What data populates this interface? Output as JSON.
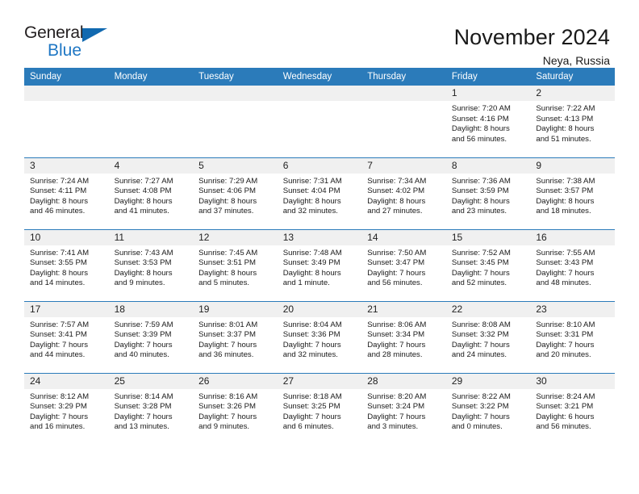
{
  "brand": {
    "name_part1": "General",
    "name_part2": "Blue"
  },
  "header": {
    "title": "November 2024",
    "location": "Neya, Russia"
  },
  "weekday_headers": [
    "Sunday",
    "Monday",
    "Tuesday",
    "Wednesday",
    "Thursday",
    "Friday",
    "Saturday"
  ],
  "colors": {
    "header_blue": "#2b7bba",
    "brand_blue": "#1f77c4",
    "daynum_band": "#f0f0f0",
    "text": "#1a1a1a"
  },
  "weeks": [
    [
      {
        "day": "",
        "empty": true
      },
      {
        "day": "",
        "empty": true
      },
      {
        "day": "",
        "empty": true
      },
      {
        "day": "",
        "empty": true
      },
      {
        "day": "",
        "empty": true
      },
      {
        "day": "1",
        "sunrise": "Sunrise: 7:20 AM",
        "sunset": "Sunset: 4:16 PM",
        "daylight1": "Daylight: 8 hours",
        "daylight2": "and 56 minutes."
      },
      {
        "day": "2",
        "sunrise": "Sunrise: 7:22 AM",
        "sunset": "Sunset: 4:13 PM",
        "daylight1": "Daylight: 8 hours",
        "daylight2": "and 51 minutes."
      }
    ],
    [
      {
        "day": "3",
        "sunrise": "Sunrise: 7:24 AM",
        "sunset": "Sunset: 4:11 PM",
        "daylight1": "Daylight: 8 hours",
        "daylight2": "and 46 minutes."
      },
      {
        "day": "4",
        "sunrise": "Sunrise: 7:27 AM",
        "sunset": "Sunset: 4:08 PM",
        "daylight1": "Daylight: 8 hours",
        "daylight2": "and 41 minutes."
      },
      {
        "day": "5",
        "sunrise": "Sunrise: 7:29 AM",
        "sunset": "Sunset: 4:06 PM",
        "daylight1": "Daylight: 8 hours",
        "daylight2": "and 37 minutes."
      },
      {
        "day": "6",
        "sunrise": "Sunrise: 7:31 AM",
        "sunset": "Sunset: 4:04 PM",
        "daylight1": "Daylight: 8 hours",
        "daylight2": "and 32 minutes."
      },
      {
        "day": "7",
        "sunrise": "Sunrise: 7:34 AM",
        "sunset": "Sunset: 4:02 PM",
        "daylight1": "Daylight: 8 hours",
        "daylight2": "and 27 minutes."
      },
      {
        "day": "8",
        "sunrise": "Sunrise: 7:36 AM",
        "sunset": "Sunset: 3:59 PM",
        "daylight1": "Daylight: 8 hours",
        "daylight2": "and 23 minutes."
      },
      {
        "day": "9",
        "sunrise": "Sunrise: 7:38 AM",
        "sunset": "Sunset: 3:57 PM",
        "daylight1": "Daylight: 8 hours",
        "daylight2": "and 18 minutes."
      }
    ],
    [
      {
        "day": "10",
        "sunrise": "Sunrise: 7:41 AM",
        "sunset": "Sunset: 3:55 PM",
        "daylight1": "Daylight: 8 hours",
        "daylight2": "and 14 minutes."
      },
      {
        "day": "11",
        "sunrise": "Sunrise: 7:43 AM",
        "sunset": "Sunset: 3:53 PM",
        "daylight1": "Daylight: 8 hours",
        "daylight2": "and 9 minutes."
      },
      {
        "day": "12",
        "sunrise": "Sunrise: 7:45 AM",
        "sunset": "Sunset: 3:51 PM",
        "daylight1": "Daylight: 8 hours",
        "daylight2": "and 5 minutes."
      },
      {
        "day": "13",
        "sunrise": "Sunrise: 7:48 AM",
        "sunset": "Sunset: 3:49 PM",
        "daylight1": "Daylight: 8 hours",
        "daylight2": "and 1 minute."
      },
      {
        "day": "14",
        "sunrise": "Sunrise: 7:50 AM",
        "sunset": "Sunset: 3:47 PM",
        "daylight1": "Daylight: 7 hours",
        "daylight2": "and 56 minutes."
      },
      {
        "day": "15",
        "sunrise": "Sunrise: 7:52 AM",
        "sunset": "Sunset: 3:45 PM",
        "daylight1": "Daylight: 7 hours",
        "daylight2": "and 52 minutes."
      },
      {
        "day": "16",
        "sunrise": "Sunrise: 7:55 AM",
        "sunset": "Sunset: 3:43 PM",
        "daylight1": "Daylight: 7 hours",
        "daylight2": "and 48 minutes."
      }
    ],
    [
      {
        "day": "17",
        "sunrise": "Sunrise: 7:57 AM",
        "sunset": "Sunset: 3:41 PM",
        "daylight1": "Daylight: 7 hours",
        "daylight2": "and 44 minutes."
      },
      {
        "day": "18",
        "sunrise": "Sunrise: 7:59 AM",
        "sunset": "Sunset: 3:39 PM",
        "daylight1": "Daylight: 7 hours",
        "daylight2": "and 40 minutes."
      },
      {
        "day": "19",
        "sunrise": "Sunrise: 8:01 AM",
        "sunset": "Sunset: 3:37 PM",
        "daylight1": "Daylight: 7 hours",
        "daylight2": "and 36 minutes."
      },
      {
        "day": "20",
        "sunrise": "Sunrise: 8:04 AM",
        "sunset": "Sunset: 3:36 PM",
        "daylight1": "Daylight: 7 hours",
        "daylight2": "and 32 minutes."
      },
      {
        "day": "21",
        "sunrise": "Sunrise: 8:06 AM",
        "sunset": "Sunset: 3:34 PM",
        "daylight1": "Daylight: 7 hours",
        "daylight2": "and 28 minutes."
      },
      {
        "day": "22",
        "sunrise": "Sunrise: 8:08 AM",
        "sunset": "Sunset: 3:32 PM",
        "daylight1": "Daylight: 7 hours",
        "daylight2": "and 24 minutes."
      },
      {
        "day": "23",
        "sunrise": "Sunrise: 8:10 AM",
        "sunset": "Sunset: 3:31 PM",
        "daylight1": "Daylight: 7 hours",
        "daylight2": "and 20 minutes."
      }
    ],
    [
      {
        "day": "24",
        "sunrise": "Sunrise: 8:12 AM",
        "sunset": "Sunset: 3:29 PM",
        "daylight1": "Daylight: 7 hours",
        "daylight2": "and 16 minutes."
      },
      {
        "day": "25",
        "sunrise": "Sunrise: 8:14 AM",
        "sunset": "Sunset: 3:28 PM",
        "daylight1": "Daylight: 7 hours",
        "daylight2": "and 13 minutes."
      },
      {
        "day": "26",
        "sunrise": "Sunrise: 8:16 AM",
        "sunset": "Sunset: 3:26 PM",
        "daylight1": "Daylight: 7 hours",
        "daylight2": "and 9 minutes."
      },
      {
        "day": "27",
        "sunrise": "Sunrise: 8:18 AM",
        "sunset": "Sunset: 3:25 PM",
        "daylight1": "Daylight: 7 hours",
        "daylight2": "and 6 minutes."
      },
      {
        "day": "28",
        "sunrise": "Sunrise: 8:20 AM",
        "sunset": "Sunset: 3:24 PM",
        "daylight1": "Daylight: 7 hours",
        "daylight2": "and 3 minutes."
      },
      {
        "day": "29",
        "sunrise": "Sunrise: 8:22 AM",
        "sunset": "Sunset: 3:22 PM",
        "daylight1": "Daylight: 7 hours",
        "daylight2": "and 0 minutes."
      },
      {
        "day": "30",
        "sunrise": "Sunrise: 8:24 AM",
        "sunset": "Sunset: 3:21 PM",
        "daylight1": "Daylight: 6 hours",
        "daylight2": "and 56 minutes."
      }
    ]
  ]
}
